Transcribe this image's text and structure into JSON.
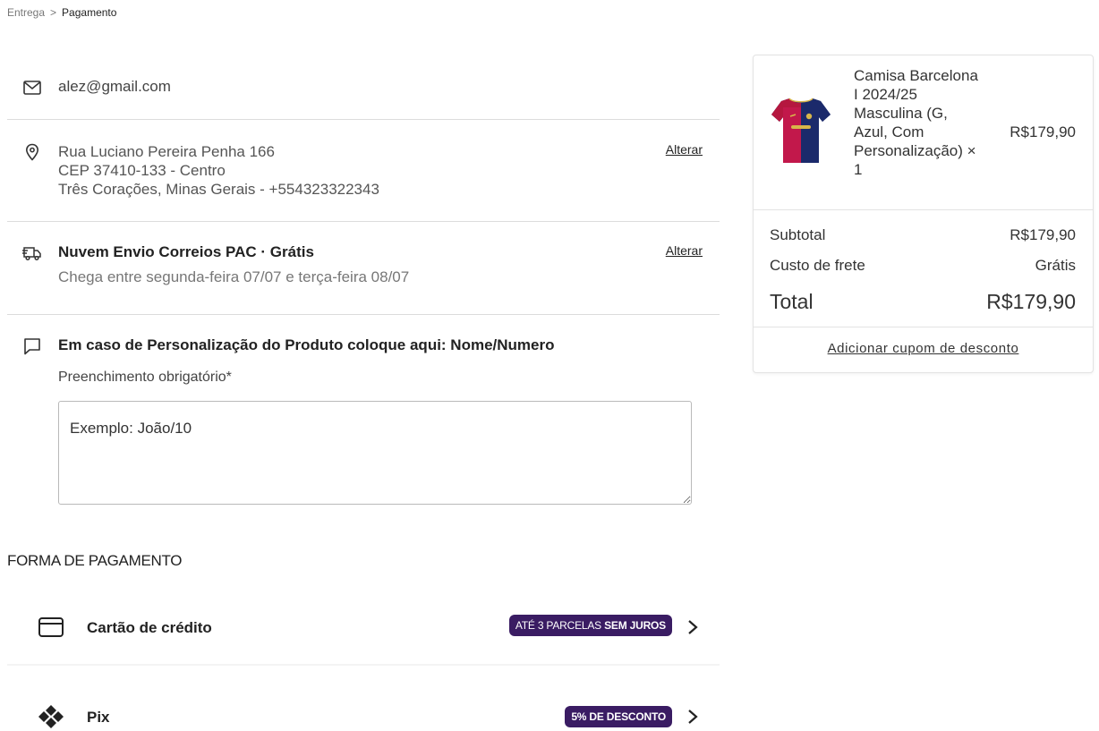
{
  "breadcrumb": {
    "step1": "Entrega",
    "separator": ">",
    "step2": "Pagamento"
  },
  "contact": {
    "icon": "mail-icon",
    "email": "alez@gmail.com"
  },
  "address": {
    "icon": "location-pin-icon",
    "line1": "Rua Luciano Pereira Penha 166",
    "line2": "CEP 37410-133 - Centro",
    "line3": "Três Corações, Minas Gerais - +554323322343",
    "change_label": "Alterar"
  },
  "shipping": {
    "icon": "truck-icon",
    "title": "Nuvem Envio Correios PAC · Grátis",
    "eta": "Chega entre segunda-feira 07/07 e terça-feira 08/07",
    "change_label": "Alterar"
  },
  "customization": {
    "icon": "chat-bubble-icon",
    "title": "Em caso de Personalização do Produto coloque aqui: Nome/Numero",
    "hint": "Preenchimento obrigatório*",
    "placeholder": "Exemplo: João/10",
    "value": ""
  },
  "payment": {
    "title": "FORMA DE PAGAMENTO",
    "options": [
      {
        "icon": "credit-card-icon",
        "label": "Cartão de crédito",
        "badge_prefix": "ATÉ 3 PARCELAS ",
        "badge_emphasis": "SEM JUROS"
      },
      {
        "icon": "pix-icon",
        "label": "Pix",
        "badge_prefix": "5% DE DESCONTO",
        "badge_emphasis": ""
      }
    ]
  },
  "summary": {
    "product": {
      "image": "barcelona-jersey-image",
      "name": "Camisa Barcelona I 2024/25 Masculina (G, Azul, Com Personalização) × 1",
      "price": "R$179,90"
    },
    "subtotal_label": "Subtotal",
    "subtotal_value": "R$179,90",
    "shipping_label": "Custo de frete",
    "shipping_value": "Grátis",
    "total_label": "Total",
    "total_value": "R$179,90",
    "coupon_label": "Adicionar cupom de desconto"
  },
  "colors": {
    "badge_bg": "#3a1c63",
    "divider": "#dcdcdc"
  }
}
